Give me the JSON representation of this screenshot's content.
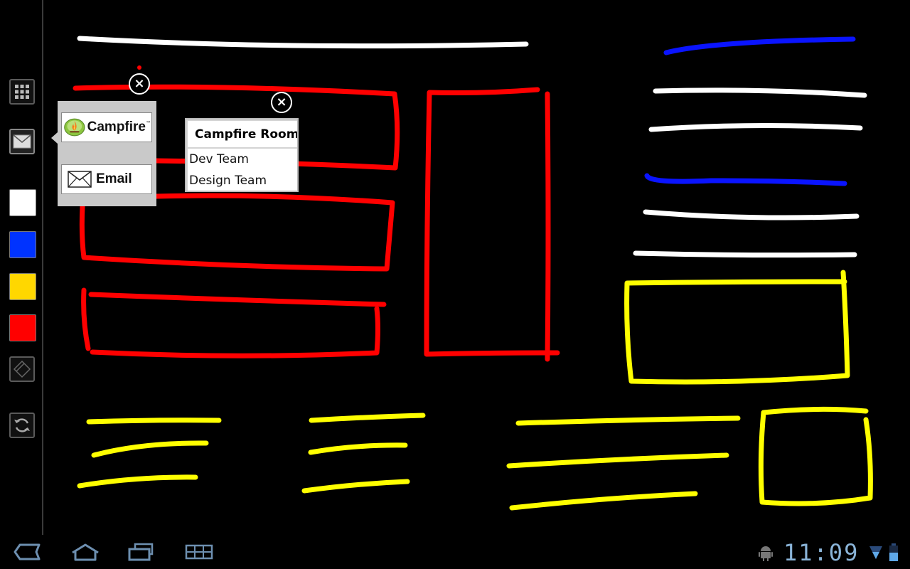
{
  "app": "whiteboard",
  "toolbar": {
    "tools": [
      {
        "name": "apps",
        "icon": "grid-icon"
      },
      {
        "name": "share",
        "icon": "envelope-icon"
      }
    ],
    "colors": [
      "#ffffff",
      "#0033ff",
      "#ffd700",
      "#ff0000"
    ],
    "eraser_icon": "eraser-icon",
    "refresh_icon": "refresh-icon"
  },
  "share_popup": {
    "campfire_label": "Campfire",
    "campfire_tm": "™",
    "email_label": "Email",
    "close_symbol": "×"
  },
  "rooms_popup": {
    "title": "Campfire Rooms",
    "rooms": [
      "Dev Team",
      "Design Team"
    ],
    "close_symbol": "×"
  },
  "navbar": {
    "back_icon": "back-icon",
    "home_icon": "home-icon",
    "recents_icon": "recents-icon",
    "menu_icon": "menu-icon"
  },
  "status": {
    "clock": "11:09",
    "android_icon": "android-icon",
    "wifi_icon": "wifi-icon",
    "battery_icon": "battery-icon"
  },
  "stroke_colors": {
    "red": "#ff0000",
    "white": "#ffffff",
    "blue": "#0a14ff",
    "yellow": "#ffff00"
  }
}
